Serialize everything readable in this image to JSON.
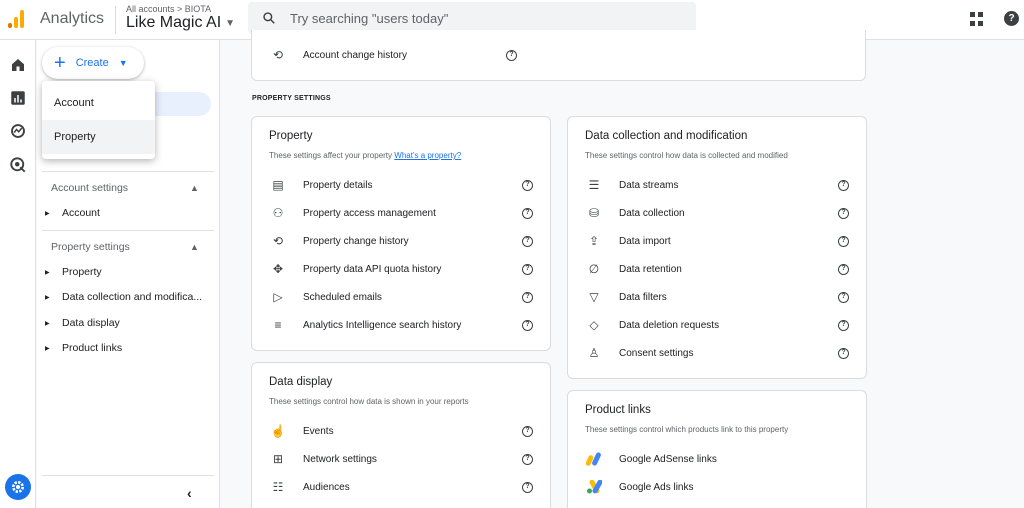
{
  "header": {
    "app_name": "Analytics",
    "breadcrumb": "All accounts > BIOTA",
    "property_name": "Like Magic AI",
    "search_placeholder": "Try searching \"users today\""
  },
  "sidebar": {
    "create_label": "Create",
    "account_settings_label": "Account settings",
    "account_items": [
      "Account"
    ],
    "property_settings_label": "Property settings",
    "property_items": [
      "Property",
      "Data collection and modifica...",
      "Data display",
      "Product links"
    ]
  },
  "create_menu": {
    "items": [
      "Account",
      "Property"
    ]
  },
  "main": {
    "top_card_item": "Account change history",
    "section_label": "PROPERTY SETTINGS",
    "property_card": {
      "title": "Property",
      "desc": "These settings affect your property",
      "desc_link": "What's a property?",
      "items": [
        {
          "label": "Property details",
          "icon": "details-icon"
        },
        {
          "label": "Property access management",
          "icon": "people-icon"
        },
        {
          "label": "Property change history",
          "icon": "history-icon"
        },
        {
          "label": "Property data API quota history",
          "icon": "quota-icon"
        },
        {
          "label": "Scheduled emails",
          "icon": "scheduled-email-icon"
        },
        {
          "label": "Analytics Intelligence search history",
          "icon": "search-history-icon"
        }
      ]
    },
    "data_collection_card": {
      "title": "Data collection and modification",
      "desc": "These settings control how data is collected and modified",
      "items": [
        {
          "label": "Data streams",
          "icon": "streams-icon"
        },
        {
          "label": "Data collection",
          "icon": "database-icon"
        },
        {
          "label": "Data import",
          "icon": "upload-icon"
        },
        {
          "label": "Data retention",
          "icon": "retention-icon"
        },
        {
          "label": "Data filters",
          "icon": "filter-icon"
        },
        {
          "label": "Data deletion requests",
          "icon": "eraser-icon"
        },
        {
          "label": "Consent settings",
          "icon": "consent-icon"
        }
      ]
    },
    "data_display_card": {
      "title": "Data display",
      "desc": "These settings control how data is shown in your reports",
      "items": [
        {
          "label": "Events",
          "icon": "touch-icon"
        },
        {
          "label": "Network settings",
          "icon": "network-icon"
        },
        {
          "label": "Audiences",
          "icon": "audiences-icon"
        }
      ]
    },
    "product_links_card": {
      "title": "Product links",
      "desc": "These settings control which products link to this property",
      "items": [
        {
          "label": "Google AdSense links",
          "icon": "adsense-icon"
        },
        {
          "label": "Google Ads links",
          "icon": "google-ads-icon"
        }
      ]
    }
  },
  "colors": {
    "accent": "#1a73e8",
    "logo_orange": "#e37400",
    "logo_yellow": "#f9ab00"
  }
}
